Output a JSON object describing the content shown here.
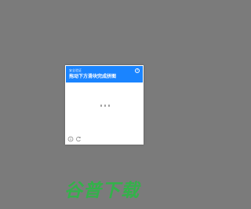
{
  "overlay": {
    "background_color": "#7b7b7b"
  },
  "captcha": {
    "subtitle": "安全验证",
    "title": "拖动下方滑块完成拼图",
    "help_icon": "help-circle-icon",
    "loading_icon": "loading-dots-icon",
    "footer_icons": [
      "info-icon",
      "refresh-icon"
    ],
    "accent_color": "#1a84ff"
  },
  "watermark": {
    "text": "谷普下载",
    "color": "#33b24a"
  }
}
